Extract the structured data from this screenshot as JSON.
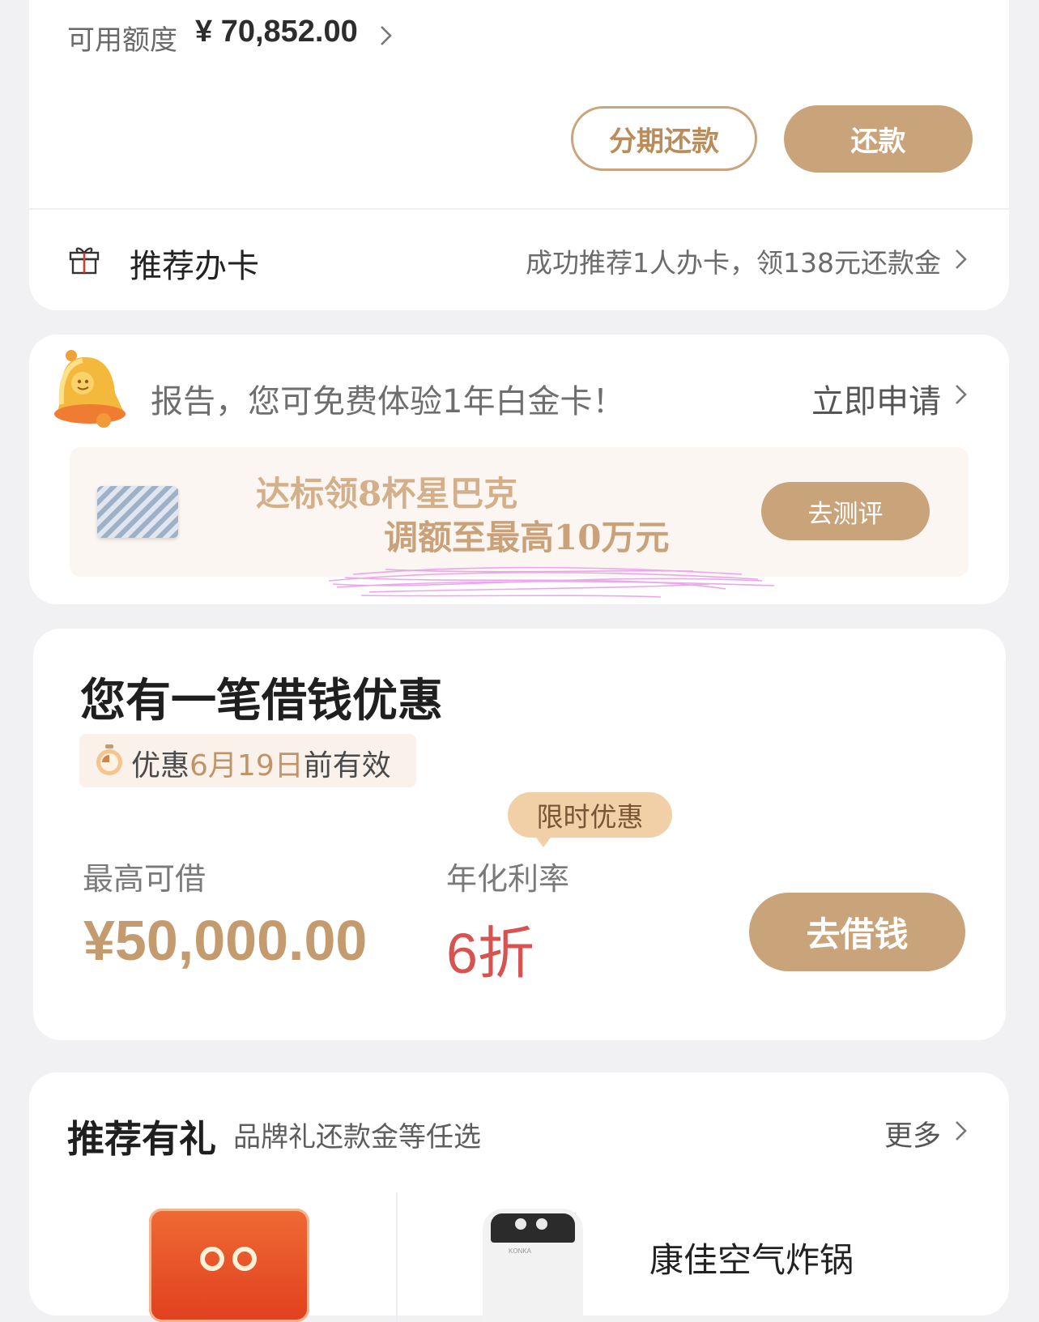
{
  "credit": {
    "label": "可用额度",
    "value": "¥ 70,852.00",
    "installment_button": "分期还款",
    "repay_button": "还款"
  },
  "referral": {
    "title": "推荐办卡",
    "description": "成功推荐1人办卡，领138元还款金"
  },
  "notice": {
    "text": "报告，您可免费体验1年白金卡！",
    "action": "立即申请"
  },
  "banner": {
    "line1": "达标领8杯星巴克",
    "line2": "调额至最高10万元",
    "button": "去测评"
  },
  "loan": {
    "title": "您有一笔借钱优惠",
    "validity_prefix": "优惠",
    "validity_date": "6月19日",
    "validity_suffix": "前有效",
    "limited_tag": "限时优惠",
    "max_label": "最高可借",
    "max_amount": "¥50,000.00",
    "rate_label": "年化利率",
    "rate_value": "6折",
    "borrow_button": "去借钱"
  },
  "recommend": {
    "title": "推荐有礼",
    "subtitle": "品牌礼还款金等任选",
    "more": "更多",
    "products": [
      {
        "name": ""
      },
      {
        "name": "康佳空气炸锅"
      }
    ]
  },
  "colors": {
    "accent_gold": "#c9a47a",
    "rate_red": "#d65350",
    "background": "#f1f1f3"
  },
  "icons": [
    "chevron-right-icon",
    "gift-icon",
    "bell-icon",
    "clock-icon"
  ]
}
